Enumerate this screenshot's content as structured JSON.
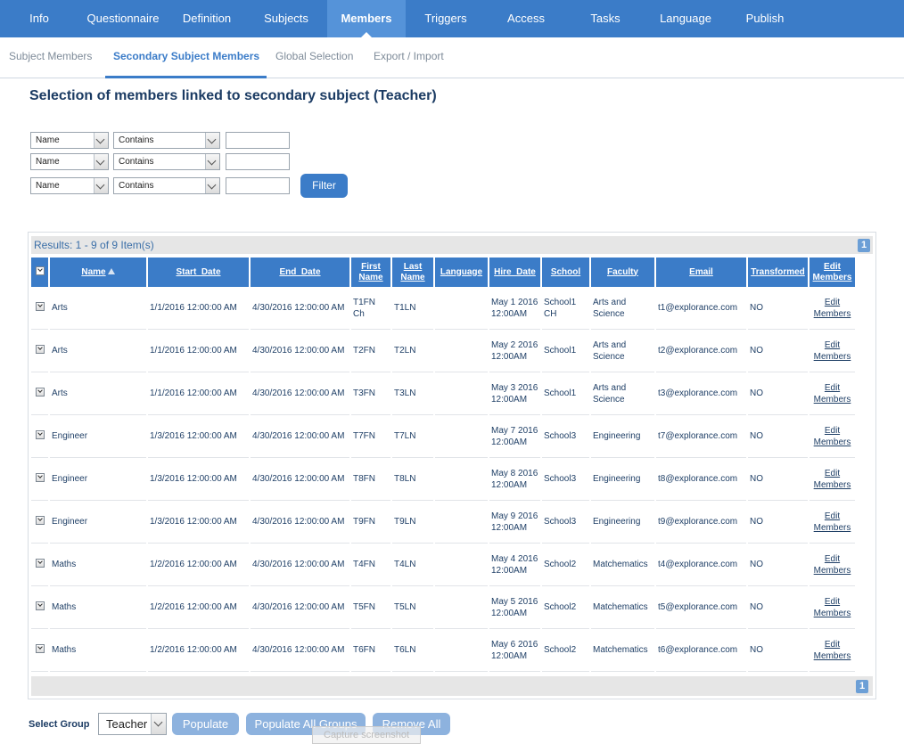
{
  "colors": {
    "primary": "#3b7cc8",
    "active_tab": "#5593d9",
    "light_button": "#8db2de"
  },
  "topnav": [
    {
      "label": "Info"
    },
    {
      "label": "Questionnaire"
    },
    {
      "label": "Definition"
    },
    {
      "label": "Subjects"
    },
    {
      "label": "Members",
      "active": true
    },
    {
      "label": "Triggers"
    },
    {
      "label": "Access"
    },
    {
      "label": "Tasks"
    },
    {
      "label": "Language"
    },
    {
      "label": "Publish"
    }
  ],
  "subnav": [
    {
      "label": "Subject Members"
    },
    {
      "label": "Secondary Subject Members",
      "active": true
    },
    {
      "label": "Global Selection"
    },
    {
      "label": "Export / Import"
    }
  ],
  "page_title": "Selection of members linked to secondary subject (Teacher)",
  "filters": [
    {
      "field": "Name",
      "operator": "Contains",
      "value": ""
    },
    {
      "field": "Name",
      "operator": "Contains",
      "value": ""
    },
    {
      "field": "Name",
      "operator": "Contains",
      "value": ""
    }
  ],
  "filter_button": "Filter",
  "results_text": "Results: 1 - 9 of 9 Item(s)",
  "page_number": "1",
  "columns": [
    "Name",
    "Start_Date",
    "End_Date",
    "First Name",
    "Last Name",
    "Language",
    "Hire_Date",
    "School",
    "Faculty",
    "Email",
    "Transformed",
    "Edit Members"
  ],
  "rows": [
    {
      "name": "Arts",
      "start": "1/1/2016 12:00:00 AM",
      "end": "4/30/2016 12:00:00 AM",
      "first": "T1FN Ch",
      "last": "T1LN",
      "language": "",
      "hire": "May 1 2016 12:00AM",
      "school": "School1 CH",
      "faculty": "Arts and Science",
      "email": "t1@explorance.com",
      "transformed": "NO",
      "edit": "Edit Members"
    },
    {
      "name": "Arts",
      "start": "1/1/2016 12:00:00 AM",
      "end": "4/30/2016 12:00:00 AM",
      "first": "T2FN",
      "last": "T2LN",
      "language": "",
      "hire": "May 2 2016 12:00AM",
      "school": "School1",
      "faculty": "Arts and Science",
      "email": "t2@explorance.com",
      "transformed": "NO",
      "edit": "Edit Members"
    },
    {
      "name": "Arts",
      "start": "1/1/2016 12:00:00 AM",
      "end": "4/30/2016 12:00:00 AM",
      "first": "T3FN",
      "last": "T3LN",
      "language": "",
      "hire": "May 3 2016 12:00AM",
      "school": "School1",
      "faculty": "Arts and Science",
      "email": "t3@explorance.com",
      "transformed": "NO",
      "edit": "Edit Members"
    },
    {
      "name": "Engineer",
      "start": "1/3/2016 12:00:00 AM",
      "end": "4/30/2016 12:00:00 AM",
      "first": "T7FN",
      "last": "T7LN",
      "language": "",
      "hire": "May 7 2016 12:00AM",
      "school": "School3",
      "faculty": "Engineering",
      "email": "t7@explorance.com",
      "transformed": "NO",
      "edit": "Edit Members"
    },
    {
      "name": "Engineer",
      "start": "1/3/2016 12:00:00 AM",
      "end": "4/30/2016 12:00:00 AM",
      "first": "T8FN",
      "last": "T8LN",
      "language": "",
      "hire": "May 8 2016 12:00AM",
      "school": "School3",
      "faculty": "Engineering",
      "email": "t8@explorance.com",
      "transformed": "NO",
      "edit": "Edit Members"
    },
    {
      "name": "Engineer",
      "start": "1/3/2016 12:00:00 AM",
      "end": "4/30/2016 12:00:00 AM",
      "first": "T9FN",
      "last": "T9LN",
      "language": "",
      "hire": "May 9 2016 12:00AM",
      "school": "School3",
      "faculty": "Engineering",
      "email": "t9@explorance.com",
      "transformed": "NO",
      "edit": "Edit Members"
    },
    {
      "name": "Maths",
      "start": "1/2/2016 12:00:00 AM",
      "end": "4/30/2016 12:00:00 AM",
      "first": "T4FN",
      "last": "T4LN",
      "language": "",
      "hire": "May 4 2016 12:00AM",
      "school": "School2",
      "faculty": "Matchematics",
      "email": "t4@explorance.com",
      "transformed": "NO",
      "edit": "Edit Members"
    },
    {
      "name": "Maths",
      "start": "1/2/2016 12:00:00 AM",
      "end": "4/30/2016 12:00:00 AM",
      "first": "T5FN",
      "last": "T5LN",
      "language": "",
      "hire": "May 5 2016 12:00AM",
      "school": "School2",
      "faculty": "Matchematics",
      "email": "t5@explorance.com",
      "transformed": "NO",
      "edit": "Edit Members"
    },
    {
      "name": "Maths",
      "start": "1/2/2016 12:00:00 AM",
      "end": "4/30/2016 12:00:00 AM",
      "first": "T6FN",
      "last": "T6LN",
      "language": "",
      "hire": "May 6 2016 12:00AM",
      "school": "School2",
      "faculty": "Matchematics",
      "email": "t6@explorance.com",
      "transformed": "NO",
      "edit": "Edit Members"
    }
  ],
  "bottom": {
    "select_group_label": "Select Group",
    "group_value": "Teacher",
    "populate": "Populate",
    "populate_all": "Populate All Groups",
    "remove_all": "Remove All",
    "capture": "Capture screenshot"
  }
}
